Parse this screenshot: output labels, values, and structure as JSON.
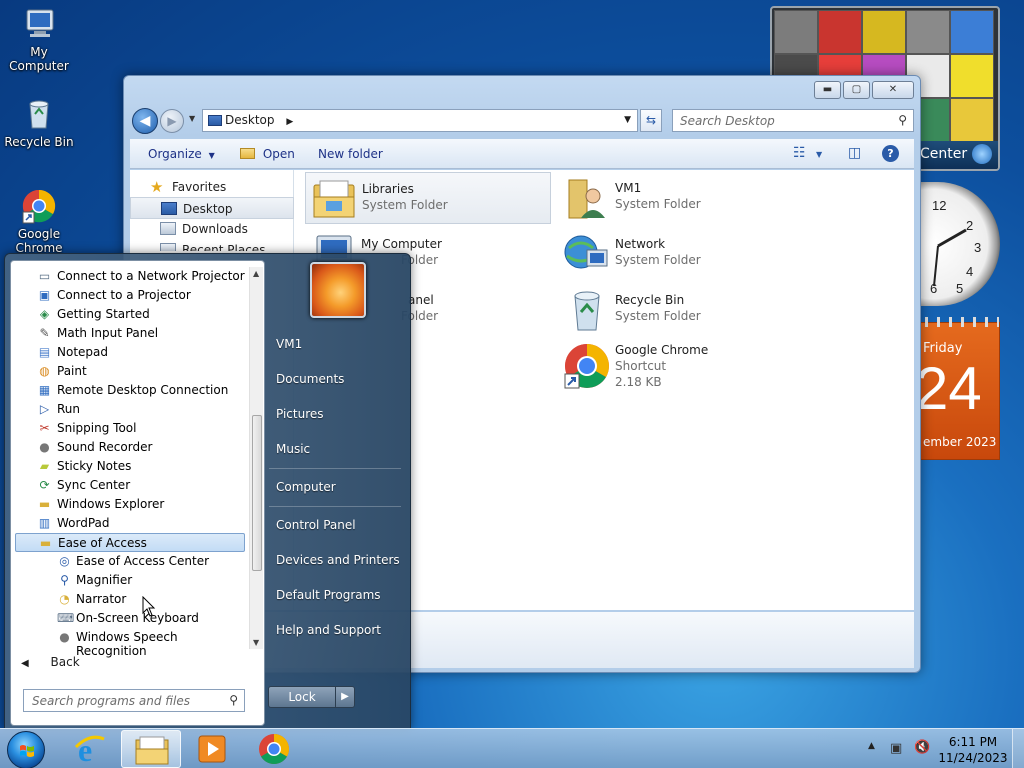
{
  "desktop": {
    "icons": [
      {
        "label": "My Computer",
        "icon": "computer-icon"
      },
      {
        "label": "Recycle Bin",
        "icon": "recycle-bin-icon"
      },
      {
        "label": "Google Chrome",
        "icon": "chrome-icon"
      }
    ]
  },
  "gadgets": {
    "media_center_label": "Center",
    "calendar": {
      "weekday": "Friday",
      "day": "24",
      "month_year": "ember 2023"
    }
  },
  "explorer": {
    "address": "Desktop",
    "search_placeholder": "Search Desktop",
    "toolbar": {
      "organize": "Organize",
      "open": "Open",
      "new_folder": "New folder"
    },
    "nav_pane": [
      {
        "label": "Favorites",
        "icon": "star-icon"
      },
      {
        "label": "Desktop",
        "icon": "desktop-icon",
        "selected": true
      },
      {
        "label": "Downloads",
        "icon": "downloads-icon"
      },
      {
        "label": "Recent Places",
        "icon": "recent-places-icon"
      }
    ],
    "items": [
      {
        "name": "Libraries",
        "sub": "System Folder",
        "sub2": "",
        "icon": "libraries-icon",
        "selected": true
      },
      {
        "name": "VM1",
        "sub": "System Folder",
        "sub2": "",
        "icon": "user-folder-icon"
      },
      {
        "name": "My Computer",
        "sub": "Folder",
        "sub2": "",
        "icon": "computer-icon"
      },
      {
        "name": "Network",
        "sub": "System Folder",
        "sub2": "",
        "icon": "network-icon"
      },
      {
        "name": "anel",
        "sub": "Folder",
        "sub2": "",
        "icon": "control-panel-icon"
      },
      {
        "name": "Recycle Bin",
        "sub": "System Folder",
        "sub2": "",
        "icon": "recycle-bin-icon"
      },
      {
        "name": "Google Chrome",
        "sub": "Shortcut",
        "sub2": "2.18 KB",
        "icon": "chrome-icon"
      }
    ]
  },
  "start_menu": {
    "programs": [
      {
        "label": "Connect to a Network Projector",
        "icon": "projector-icon",
        "indent": false
      },
      {
        "label": "Connect to a Projector",
        "icon": "monitor-icon",
        "indent": false
      },
      {
        "label": "Getting Started",
        "icon": "getting-started-icon",
        "indent": false
      },
      {
        "label": "Math Input Panel",
        "icon": "math-input-icon",
        "indent": false
      },
      {
        "label": "Notepad",
        "icon": "notepad-icon",
        "indent": false
      },
      {
        "label": "Paint",
        "icon": "paint-icon",
        "indent": false
      },
      {
        "label": "Remote Desktop Connection",
        "icon": "remote-desktop-icon",
        "indent": false
      },
      {
        "label": "Run",
        "icon": "run-icon",
        "indent": false
      },
      {
        "label": "Snipping Tool",
        "icon": "scissors-icon",
        "indent": false
      },
      {
        "label": "Sound Recorder",
        "icon": "microphone-icon",
        "indent": false
      },
      {
        "label": "Sticky Notes",
        "icon": "sticky-notes-icon",
        "indent": false
      },
      {
        "label": "Sync Center",
        "icon": "sync-icon",
        "indent": false
      },
      {
        "label": "Windows Explorer",
        "icon": "folder-icon",
        "indent": false
      },
      {
        "label": "WordPad",
        "icon": "wordpad-icon",
        "indent": false
      },
      {
        "label": "Ease of Access",
        "icon": "folder-icon",
        "indent": false,
        "selected": true
      },
      {
        "label": "Ease of Access Center",
        "icon": "ease-of-access-icon",
        "indent": true
      },
      {
        "label": "Magnifier",
        "icon": "magnifier-icon",
        "indent": true
      },
      {
        "label": "Narrator",
        "icon": "narrator-icon",
        "indent": true
      },
      {
        "label": "On-Screen Keyboard",
        "icon": "keyboard-icon",
        "indent": true
      },
      {
        "label": "Windows Speech Recognition",
        "icon": "microphone-icon",
        "indent": true
      }
    ],
    "back_label": "Back",
    "search_placeholder": "Search programs and files",
    "right_items": [
      "VM1",
      "Documents",
      "Pictures",
      "Music",
      "Computer",
      "Control Panel",
      "Devices and Printers",
      "Default Programs",
      "Help and Support"
    ],
    "lock_label": "Lock"
  },
  "taskbar": {
    "apps": [
      {
        "name": "internet-explorer-icon",
        "active": false
      },
      {
        "name": "windows-explorer-icon",
        "active": true
      },
      {
        "name": "media-player-icon",
        "active": false
      },
      {
        "name": "chrome-icon",
        "active": false
      }
    ],
    "time": "6:11 PM",
    "date": "11/24/2023"
  }
}
